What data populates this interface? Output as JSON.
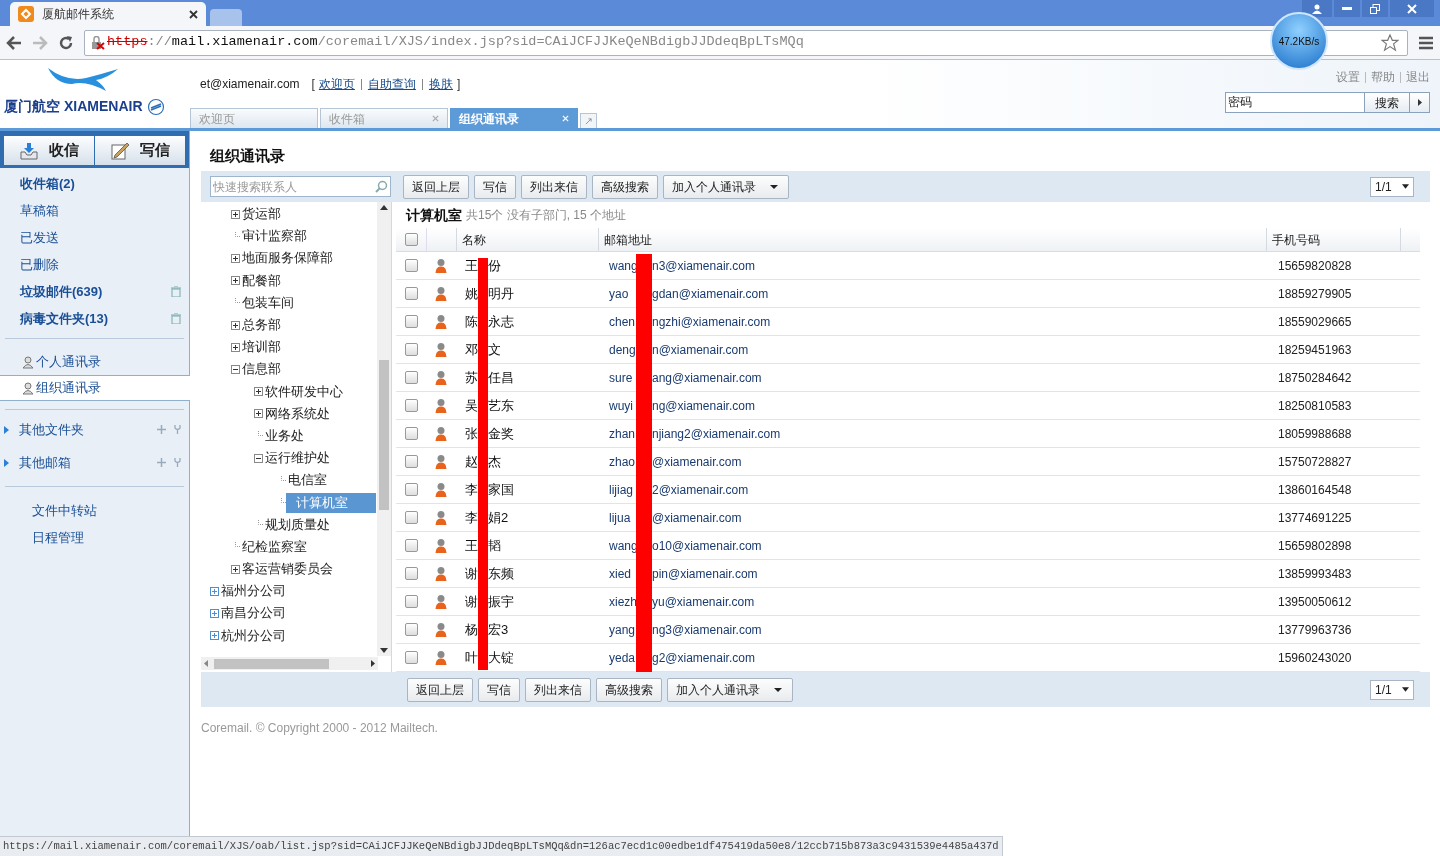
{
  "browser": {
    "tab_title": "厦航邮件系统",
    "url": {
      "scheme": "https",
      "separator": "://",
      "host": "mail.xiamenair.com",
      "path": "/coremail/XJS/index.jsp?sid=CAiJCFJJKeQeNBdigbJJDdeqBpLTsMQq"
    },
    "speed": "47.2KB/s"
  },
  "header": {
    "logo_cn": "厦门航空",
    "logo_en": "XIAMENAIR",
    "account": "et@xiamenair.com",
    "bracket_open": "[",
    "bracket_close": "]",
    "links": [
      "欢迎页",
      "自助查询",
      "换肤"
    ],
    "top_links": [
      "设置",
      "帮助",
      "退出"
    ],
    "search": {
      "value": "密码",
      "button": "搜索"
    },
    "tabs": [
      {
        "label": "欢迎页",
        "selected": false,
        "closable": false
      },
      {
        "label": "收件箱",
        "selected": false,
        "closable": true
      },
      {
        "label": "组织通讯录",
        "selected": true,
        "closable": true
      }
    ]
  },
  "sidebar": {
    "actions": [
      "收信",
      "写信"
    ],
    "folders": [
      {
        "label": "收件箱(2)",
        "bold": true,
        "clearable": false
      },
      {
        "label": "草稿箱",
        "bold": false,
        "clearable": false
      },
      {
        "label": "已发送",
        "bold": false,
        "clearable": false
      },
      {
        "label": "已删除",
        "bold": false,
        "clearable": false
      },
      {
        "label": "垃圾邮件(639)",
        "bold": true,
        "clearable": true
      },
      {
        "label": "病毒文件夹(13)",
        "bold": true,
        "clearable": true
      }
    ],
    "address_books": [
      {
        "label": "个人通讯录",
        "selected": false
      },
      {
        "label": "组织通讯录",
        "selected": true
      }
    ],
    "groups": [
      "其他文件夹",
      "其他邮箱"
    ],
    "tools": [
      "文件中转站",
      "日程管理"
    ]
  },
  "page_title": "组织通讯录",
  "contact_search": {
    "placeholder": "快速搜索联系人"
  },
  "tree": {
    "partial_branch": [
      {
        "label": "货运部",
        "kind": "collapsed",
        "selected": false
      },
      {
        "label": "审计监察部",
        "kind": "leaf",
        "selected": false
      },
      {
        "label": "地面服务保障部",
        "kind": "collapsed",
        "selected": false
      },
      {
        "label": "配餐部",
        "kind": "collapsed",
        "selected": false
      },
      {
        "label": "包装车间",
        "kind": "leaf",
        "selected": false
      },
      {
        "label": "总务部",
        "kind": "collapsed",
        "selected": false
      },
      {
        "label": "培训部",
        "kind": "collapsed",
        "selected": false
      },
      {
        "label": "信息部",
        "kind": "expanded",
        "selected": false,
        "children": [
          {
            "label": "软件研发中心",
            "kind": "collapsed",
            "selected": false
          },
          {
            "label": "网络系统处",
            "kind": "collapsed",
            "selected": false
          },
          {
            "label": "业务处",
            "kind": "leaf",
            "selected": false
          },
          {
            "label": "运行维护处",
            "kind": "expanded",
            "selected": false,
            "children": [
              {
                "label": "电信室",
                "kind": "leaf",
                "selected": false
              },
              {
                "label": "计算机室",
                "kind": "leaf",
                "selected": true
              }
            ]
          },
          {
            "label": "规划质量处",
            "kind": "leaf",
            "selected": false
          }
        ]
      },
      {
        "label": "纪检监察室",
        "kind": "leaf",
        "selected": false
      },
      {
        "label": "客运营销委员会",
        "kind": "collapsed",
        "selected": false
      }
    ],
    "items": [
      {
        "label": "福州分公司",
        "kind": "collapsed",
        "selected": false
      },
      {
        "label": "南昌分公司",
        "kind": "collapsed",
        "selected": false
      },
      {
        "label": "杭州分公司",
        "kind": "collapsed",
        "selected": false
      }
    ]
  },
  "toolbar_top": {
    "buttons": [
      "返回上层",
      "写信",
      "列出来信",
      "高级搜索"
    ],
    "dropdown": "加入个人通讯录",
    "pager": "1/1"
  },
  "list": {
    "title": "计算机室",
    "select_all_checked": false,
    "summary": "共15个 没有子部门, 15 个地址",
    "columns": [
      "名称",
      "邮箱地址",
      "手机号码"
    ],
    "rows": [
      {
        "name_head": "王",
        "name_tail": "份",
        "email_head": "wang",
        "email_tail": "n3@xiamenair.com",
        "phone": "15659820828",
        "checked": false
      },
      {
        "name_head": "姚",
        "name_tail": "明丹",
        "email_head": "yao",
        "email_tail": "gdan@xiamenair.com",
        "phone": "18859279905",
        "checked": false
      },
      {
        "name_head": "陈",
        "name_tail": "永志",
        "email_head": "chen",
        "email_tail": "ngzhi@xiamenair.com",
        "phone": "18559029665",
        "checked": false
      },
      {
        "name_head": "邓",
        "name_tail": "文",
        "email_head": "deng",
        "email_tail": "n@xiamenair.com",
        "phone": "18259451963",
        "checked": false
      },
      {
        "name_head": "苏",
        "name_tail": "任昌",
        "email_head": "sure",
        "email_tail": "ang@xiamenair.com",
        "phone": "18750284642",
        "checked": false
      },
      {
        "name_head": "吴",
        "name_tail": "艺东",
        "email_head": "wuyi",
        "email_tail": "ng@xiamenair.com",
        "phone": "18250810583",
        "checked": false
      },
      {
        "name_head": "张",
        "name_tail": "金奖",
        "email_head": "zhan",
        "email_tail": "njiang2@xiamenair.com",
        "phone": "18059988688",
        "checked": false
      },
      {
        "name_head": "赵",
        "name_tail": "杰",
        "email_head": "zhao",
        "email_tail": "@xiamenair.com",
        "phone": "15750728827",
        "checked": false
      },
      {
        "name_head": "李",
        "name_tail": "家国",
        "email_head": "lijiag",
        "email_tail": "2@xiamenair.com",
        "phone": "13860164548",
        "checked": false
      },
      {
        "name_head": "李",
        "name_tail": "娟2",
        "email_head": "lijua",
        "email_tail": "@xiamenair.com",
        "phone": "13774691225",
        "checked": false
      },
      {
        "name_head": "王",
        "name_tail": "韬",
        "email_head": "wang",
        "email_tail": "o10@xiamenair.com",
        "phone": "15659802898",
        "checked": false
      },
      {
        "name_head": "谢",
        "name_tail": "东频",
        "email_head": "xied",
        "email_tail": "pin@xiamenair.com",
        "phone": "13859993483",
        "checked": false
      },
      {
        "name_head": "谢",
        "name_tail": "振宇",
        "email_head": "xiezh",
        "email_tail": "yu@xiamenair.com",
        "phone": "13950050612",
        "checked": false
      },
      {
        "name_head": "杨",
        "name_tail": "宏3",
        "email_head": "yang",
        "email_tail": "ng3@xiamenair.com",
        "phone": "13779963736",
        "checked": false
      },
      {
        "name_head": "叶",
        "name_tail": "大锭",
        "email_head": "yeda",
        "email_tail": "g2@xiamenair.com",
        "phone": "15960243020",
        "checked": false
      }
    ]
  },
  "toolbar_bottom": {
    "buttons": [
      "返回上层",
      "写信",
      "列出来信",
      "高级搜索"
    ],
    "dropdown": "加入个人通讯录",
    "pager": "1/1"
  },
  "copyright": "Coremail. © Copyright 2000 - 2012 Mailtech.",
  "status_url": "https://mail.xiamenair.com/coremail/XJS/oab/list.jsp?sid=CAiJCFJJKeQeNBdigbJJDdeqBpLTsMQq&dn=126ac7ecd1c00edbe1df475419da50e8/12ccb715b873a3c9431539e4485a437d"
}
